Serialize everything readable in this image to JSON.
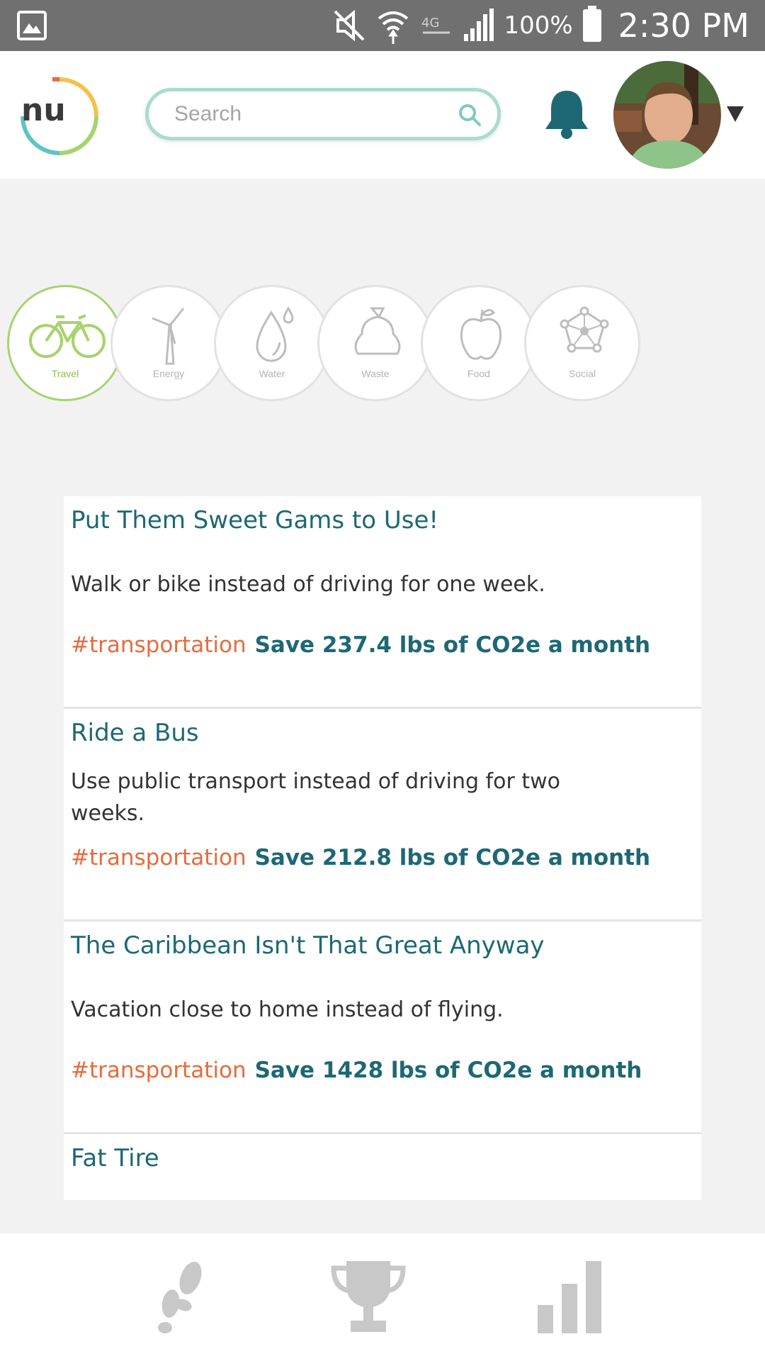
{
  "status_bar": {
    "battery": "100%",
    "time": "2:30 PM",
    "icons": [
      "gallery-icon",
      "mute-icon",
      "wifi-icon",
      "lte-icon",
      "signal-icon",
      "battery-icon"
    ]
  },
  "header": {
    "logo_text": "nu",
    "search": {
      "placeholder": "Search",
      "value": ""
    },
    "icons": [
      "bell-icon",
      "avatar",
      "caret-down-icon"
    ]
  },
  "categories": [
    {
      "label": "Travel",
      "icon": "bike-icon",
      "active": true
    },
    {
      "label": "Energy",
      "icon": "wind-turbine-icon",
      "active": false
    },
    {
      "label": "Water",
      "icon": "water-drop-icon",
      "active": false
    },
    {
      "label": "Waste",
      "icon": "trash-bag-icon",
      "active": false
    },
    {
      "label": "Food",
      "icon": "apple-icon",
      "active": false
    },
    {
      "label": "Social",
      "icon": "network-icon",
      "active": false
    }
  ],
  "actions": [
    {
      "title": "Put Them Sweet Gams to Use!",
      "description": "Walk or bike instead of driving for one week.",
      "tag": "#transportation",
      "savings": "Save 237.4 lbs of CO2e a month"
    },
    {
      "title": "Ride a Bus",
      "description": "Use public transport instead of driving for two weeks.",
      "tag": "#transportation",
      "savings": "Save 212.8 lbs of CO2e a month"
    },
    {
      "title": "The Caribbean Isn't That Great Anyway",
      "description": "Vacation close to home instead of flying.",
      "tag": "#transportation",
      "savings": "Save 1428 lbs of CO2e a month"
    },
    {
      "title": "Fat Tire",
      "description": "",
      "tag": "",
      "savings": ""
    }
  ],
  "bottom_nav": [
    "footsteps-icon",
    "trophy-icon",
    "bar-chart-icon"
  ],
  "colors": {
    "teal": "#1d6874",
    "orange": "#e96a3c",
    "green": "#a6d36e",
    "statusbar": "#707070"
  }
}
